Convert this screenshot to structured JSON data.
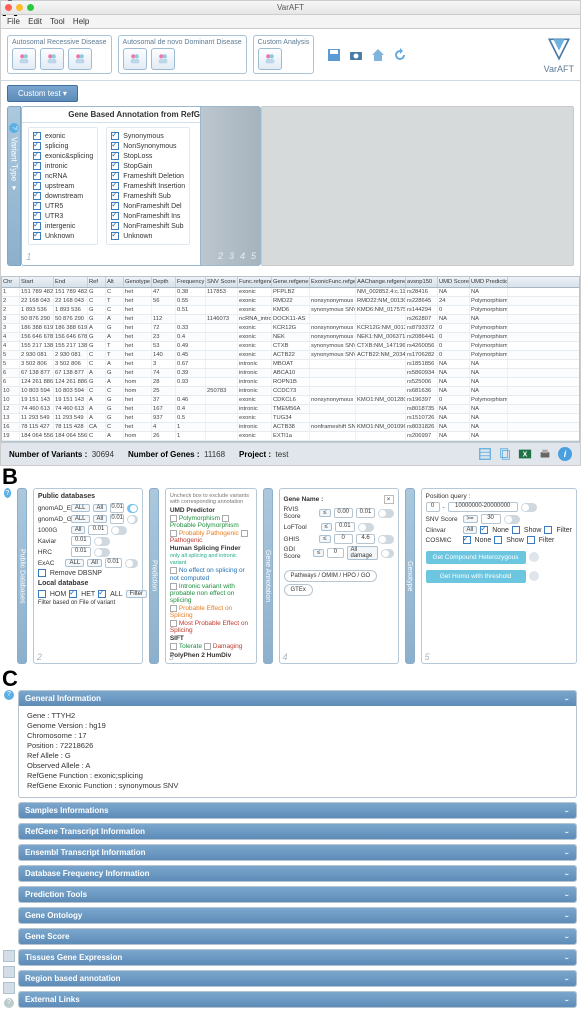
{
  "panelA_label": "A",
  "panelB_label": "B",
  "panelC_label": "C",
  "app_title": "VarAFT",
  "menubar": [
    "File",
    "Edit",
    "Tool",
    "Help"
  ],
  "toolbar": {
    "groups": [
      {
        "title": "Autosomal Recessive Disease",
        "icons": [
          "single",
          "trio",
          "pedigree"
        ]
      },
      {
        "title": "Autosomal de novo Dominant Disease",
        "icons": [
          "single",
          "trio"
        ]
      },
      {
        "title": "Custom Analysis",
        "icons": [
          "group"
        ]
      }
    ],
    "loose": [
      "save-icon",
      "camera-icon",
      "home-icon",
      "refresh-icon"
    ],
    "logo": "VarAFT"
  },
  "custom_test": "Custom test ▾",
  "vartype_tab": "Variant Type ▾",
  "annot_title": "Gene Based Annotation from RefGene",
  "annot_cols": [
    [
      "exonic",
      "splicing",
      "exonic&splicing",
      "intronic",
      "ncRNA",
      "upstream",
      "downstream",
      "UTR5",
      "UTR3",
      "intergenic",
      "Unknown"
    ],
    [
      "Synonymous",
      "NonSynonymous",
      "StopLoss",
      "StopGain",
      "Frameshift Deletion",
      "Frameshift Insertion",
      "Frameshift Sub",
      "NonFrameshift Del",
      "NonFrameshift Ins",
      "NonFrameshift Sub",
      "Unknown"
    ]
  ],
  "annot_nums": [
    "1",
    "2",
    "3",
    "4",
    "5"
  ],
  "table": {
    "headers": [
      "Chr",
      "Start",
      "End",
      "Ref",
      "Alt",
      "Genotype",
      "Depth",
      "Frequency",
      "SNV Score",
      "Func.refgene",
      "Gene.refgene",
      "ExonicFunc.refgene",
      "AAChange.refgene",
      "avsnp150",
      "UMD Score",
      "UMD Prediction"
    ],
    "rows": [
      [
        "1",
        "151 789 482",
        "151 789 482",
        "G",
        "C",
        "het",
        "47",
        "0.38",
        "117853",
        "exonic",
        "PFPLB2",
        "",
        "NM_002852.4:c.1130…",
        "rs28416",
        "NA",
        "NA"
      ],
      [
        "2",
        "22 168 043",
        "22 168 043",
        "C",
        "T",
        "het",
        "56",
        "0.55",
        "",
        "exonic",
        "RMD22",
        "nonsynonymous SNV",
        "RMD22:NM_001308…",
        "rs228645",
        "24",
        "Polymorphism"
      ],
      [
        "2",
        "1 893 536",
        "1 893 536",
        "G",
        "C",
        "het",
        "",
        "0.51",
        "",
        "exonic",
        "KMD6",
        "synonymous SNV",
        "KMD6:NM_017575:exo…",
        "rs144294",
        "0",
        "Polymorphism"
      ],
      [
        "3",
        "50 876 290",
        "50 876 290",
        "G",
        "A",
        "het",
        "112",
        "",
        "1146073",
        "ncRNA_intronic",
        "DOCK11-AS",
        "",
        "",
        "rs262807",
        "NA",
        "NA"
      ],
      [
        "3",
        "186 388 619",
        "186 388 619",
        "A",
        "G",
        "het",
        "72",
        "0.33",
        "",
        "exonic",
        "KCR12G",
        "nonsynonymous SNV",
        "KCR12G:NM_001308…",
        "rs8793372",
        "0",
        "Polymorphism"
      ],
      [
        "4",
        "156 646 678",
        "156 646 678",
        "G",
        "A",
        "het",
        "23",
        "0.4",
        "",
        "exonic",
        "NEK",
        "nonsynonymous SNV",
        "NEK1:NM_006371:ex…",
        "rs2086441",
        "0",
        "Polymorphism"
      ],
      [
        "4",
        "155 217 138",
        "155 217 138",
        "G",
        "T",
        "het",
        "53",
        "0.49",
        "",
        "exonic",
        "CTXB",
        "synonymous SNV",
        "CTXB:NM_147196:ex…",
        "rs4260056",
        "0",
        "Polymorphism"
      ],
      [
        "5",
        "2 930 081",
        "2 930 081",
        "C",
        "T",
        "het",
        "140",
        "0.45",
        "",
        "exonic",
        "ACTB22",
        "synonymous SNV",
        "ACTB22:NM_203405…",
        "rs1706282",
        "0",
        "Polymorphism"
      ],
      [
        "5",
        "3 502 806",
        "3 502 806",
        "C",
        "A",
        "het",
        "3",
        "0.67",
        "",
        "intronic",
        "MBOAT",
        "",
        "",
        "rs1851856",
        "NA",
        "NA"
      ],
      [
        "6",
        "67 138 877",
        "67 138 877",
        "A",
        "G",
        "het",
        "74",
        "0.39",
        "",
        "intronic",
        "ABCA10",
        "",
        "",
        "rs5860934",
        "NA",
        "NA"
      ],
      [
        "6",
        "124 261 886",
        "124 261 886",
        "G",
        "A",
        "hom",
        "28",
        "0.93",
        "",
        "intronic",
        "ROPN1B",
        "",
        "",
        "rs525006",
        "NA",
        "NA"
      ],
      [
        "10",
        "10 803 594",
        "10 803 594",
        "C",
        "C",
        "hom",
        "25",
        "",
        "250783",
        "intronic",
        "CCDC73",
        "",
        "",
        "rs681636",
        "NA",
        "NA"
      ],
      [
        "10",
        "19 151 143",
        "19 151 143",
        "A",
        "G",
        "het",
        "37",
        "0.46",
        "",
        "exonic",
        "CDKCL6",
        "nonsynonymous SNV",
        "KMO1:NM_001280:ex…",
        "rs196397",
        "0",
        "Polymorphism"
      ],
      [
        "12",
        "74 460 613",
        "74 460 613",
        "A",
        "G",
        "het",
        "167",
        "0.4",
        "",
        "intronic",
        "TMEM56A",
        "",
        "",
        "rs8018735",
        "NA",
        "NA"
      ],
      [
        "13",
        "11 293 549",
        "11 293 549",
        "A",
        "G",
        "het",
        "937",
        "0.5",
        "",
        "exonic",
        "TUG34",
        "",
        "",
        "rs1510726",
        "NA",
        "NA"
      ],
      [
        "16",
        "78 115 427",
        "78 115 428",
        "CA",
        "C",
        "het",
        "4",
        "1",
        "",
        "intronic",
        "ACTB38",
        "nonframeshift SNV",
        "KMO1:NM_001096:ex…",
        "rs8031826",
        "NA",
        "NA"
      ],
      [
        "19",
        "184 064 556",
        "184 064 556",
        "C",
        "A",
        "hom",
        "26",
        "1",
        "",
        "exonic",
        "EXTl1a",
        "",
        "",
        "rs206997",
        "NA",
        "NA"
      ]
    ]
  },
  "status": {
    "variants_lbl": "Number of Variants :",
    "variants_val": "30694",
    "genes_lbl": "Number of Genes :",
    "genes_val": "11168",
    "project_lbl": "Project :",
    "project_val": "test"
  },
  "panelB": {
    "tab2": "Public Databases",
    "dbs": {
      "title_pub": "Public databases",
      "rows": [
        {
          "name": "gnomAD_E",
          "all": "ALL",
          "af": "All",
          "v": "0.01",
          "tog": true
        },
        {
          "name": "gnomAD_G",
          "all": "ALL",
          "af": "All",
          "v": "0.01",
          "tog": false
        },
        {
          "name": "1000G",
          "all": "",
          "af": "All",
          "v": "0.01",
          "tog": false
        },
        {
          "name": "Kaviar",
          "all": "",
          "af": "",
          "v": "0.01",
          "tog": false
        },
        {
          "name": "HRC",
          "all": "",
          "af": "",
          "v": "0.01",
          "tog": false
        },
        {
          "name": "ExAC",
          "all": "ALL",
          "af": "All",
          "v": "0.01",
          "tog": false
        }
      ],
      "remove": "Remove DBSNP",
      "title_loc": "Local database",
      "hom": "HOM",
      "het": "HET",
      "all": "ALL",
      "filter": "Filter",
      "filter_file": "Filter based on File of variant"
    },
    "cardnum2": "2",
    "tab3": "Prediction",
    "pred": {
      "unclick": "Uncheck box to exclude variants with corresponding annotation",
      "umd_t": "UMD Predictor",
      "umd": [
        "Polymorphism",
        "Probable Polymorphism",
        "Probably Pathogenic",
        "Pathogenic"
      ],
      "hsf_t": "Human Splicing Finder",
      "hsf_sub": "only all splicing and intronic variant",
      "hsf": [
        "No effect on splicing or not computed",
        "Intronic variant with probable non effect on splicing",
        "Probable Effect on Splicing",
        "Most Probable Effect on Splicing"
      ],
      "sift_t": "SIFT",
      "sift": [
        "Tolerate",
        "Damaging"
      ],
      "pph_t": "PolyPhen 2 HumDiv"
    },
    "cardnum3": "3",
    "tab4": "Gene Annotation",
    "gene": {
      "name_lbl": "Gene Name :",
      "close": "×",
      "rvis_lbl": "RVIS Score",
      "rvis_a": "0.00",
      "rvis_b": "0.01",
      "loftool_lbl": "LoFTool",
      "loft": "0.01",
      "ghis_lbl": "GHIS",
      "ghis_a": "0",
      "ghis_b": "4.6",
      "gdi_lbl": "GDI Score",
      "gdi_a": "0",
      "gdi_sel": "All damage",
      "pill1": "Pathways / OMIM / HPO / GO",
      "pill2": "GTEx"
    },
    "cardnum4": "4",
    "tab5": "Genotype",
    "out": {
      "pos_lbl": "Position query :",
      "range_a": "0",
      "range_b": "10000000-20000000",
      "snv_lbl": "SNV Score",
      "snv_op": ">=",
      "snv_v": "30",
      "clinvar_lbl": "Clinvar",
      "clinvar_sel": "All",
      "cosmic_lbl": "COSMIC",
      "none": "None",
      "show": "Show",
      "filter": "Filter",
      "btn1": "Get Compound Heterozygous",
      "btn2": "Get Homo with threshold"
    },
    "cardnum5": "5"
  },
  "panelC": {
    "help": "?",
    "gen_info": "General Information",
    "body": [
      "Gene : TTYH2",
      "Genome Version : hg19",
      "Chromosome : 17",
      "Position : 72218626",
      "Ref Allele : G",
      "Observed Allele : A",
      "RefGene Function : exonic;splicing",
      "RefGene Exonic Function : synonymous SNV"
    ],
    "sections": [
      "Samples Informations",
      "RefGene Transcript Information",
      "Ensembl Transcript Information",
      "Database Frequency Information",
      "Prediction Tools",
      "Gene Ontology",
      "Gene Score",
      "Tissues Gene Expression",
      "Region based annotation",
      "External Links"
    ]
  }
}
